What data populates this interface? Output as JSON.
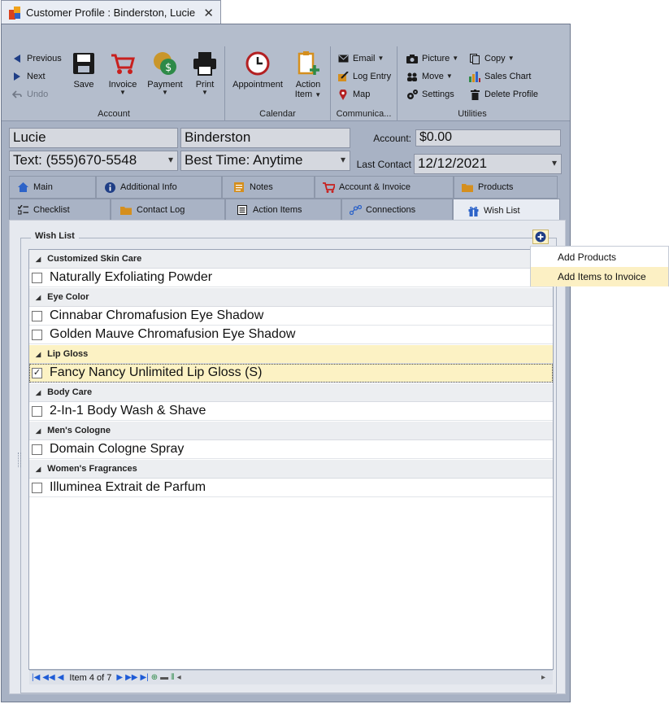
{
  "window": {
    "title": "Customer Profile : Binderston, Lucie",
    "close_glyph": "✕"
  },
  "ribbon": {
    "nav": {
      "previous": "Previous",
      "next": "Next",
      "undo": "Undo"
    },
    "account": {
      "group": "Account",
      "save": "Save",
      "invoice": "Invoice",
      "payment": "Payment",
      "print": "Print"
    },
    "calendar": {
      "group": "Calendar",
      "appointment": "Appointment",
      "action_item_1": "Action",
      "action_item_2": "Item"
    },
    "communication": {
      "group": "Communica...",
      "email": "Email",
      "log_entry": "Log Entry",
      "map": "Map"
    },
    "utilities": {
      "group": "Utilities",
      "picture": "Picture",
      "move": "Move",
      "settings": "Settings",
      "copy": "Copy",
      "sales_chart": "Sales Chart",
      "delete_profile": "Delete Profile"
    }
  },
  "profile": {
    "first_name": "Lucie",
    "last_name": "Binderston",
    "phone": "Text: (555)670-5548",
    "best_time": "Best Time: Anytime",
    "account_label": "Account:",
    "account_value": "$0.00",
    "last_contact_label": "Last Contact",
    "last_contact_value": "12/12/2021"
  },
  "tabs": {
    "main": "Main",
    "additional_info": "Additional Info",
    "notes": "Notes",
    "account_invoice": "Account & Invoice",
    "products": "Products",
    "checklist": "Checklist",
    "contact_log": "Contact Log",
    "action_items": "Action Items",
    "connections": "Connections",
    "wish_list": "Wish List"
  },
  "wishlist": {
    "title": "Wish List",
    "groups": [
      {
        "name": "Customized Skin Care",
        "items": [
          {
            "label": "Naturally Exfoliating Powder",
            "checked": false
          }
        ]
      },
      {
        "name": "Eye Color",
        "items": [
          {
            "label": "Cinnabar Chromafusion Eye Shadow",
            "checked": false
          },
          {
            "label": "Golden Mauve Chromafusion Eye Shadow",
            "checked": false
          }
        ]
      },
      {
        "name": "Lip Gloss",
        "items": [
          {
            "label": "Fancy Nancy Unlimited Lip Gloss (S)",
            "checked": true
          }
        ]
      },
      {
        "name": "Body Care",
        "items": [
          {
            "label": "2-In-1 Body Wash & Shave",
            "checked": false
          }
        ]
      },
      {
        "name": "Men's Cologne",
        "items": [
          {
            "label": "Domain Cologne Spray",
            "checked": false
          }
        ]
      },
      {
        "name": "Women's Fragrances",
        "items": [
          {
            "label": "Illuminea Extrait de Parfum",
            "checked": false
          }
        ]
      }
    ],
    "navigator": "Item 4 of 7"
  },
  "context_menu": {
    "add_products": "Add Products",
    "add_items_to_invoice": "Add Items to Invoice"
  },
  "colors": {
    "ribbon": "#b4bdcc",
    "window": "#a8b2c4",
    "highlight": "#fcf2c4",
    "accent_blue": "#1e5bd6"
  },
  "icons": [
    "app-icon",
    "close-icon",
    "previous-icon",
    "next-icon",
    "undo-icon",
    "save-icon",
    "cart-icon",
    "payment-icon",
    "printer-icon",
    "clock-icon",
    "action-item-icon",
    "email-icon",
    "log-entry-icon",
    "map-pin-icon",
    "camera-icon",
    "move-icon",
    "settings-icon",
    "copy-icon",
    "sales-chart-icon",
    "trash-icon",
    "home-icon",
    "info-icon",
    "notes-icon",
    "folder-icon",
    "checklist-icon",
    "list-icon",
    "connections-icon",
    "gift-icon",
    "plus-circle-icon"
  ]
}
